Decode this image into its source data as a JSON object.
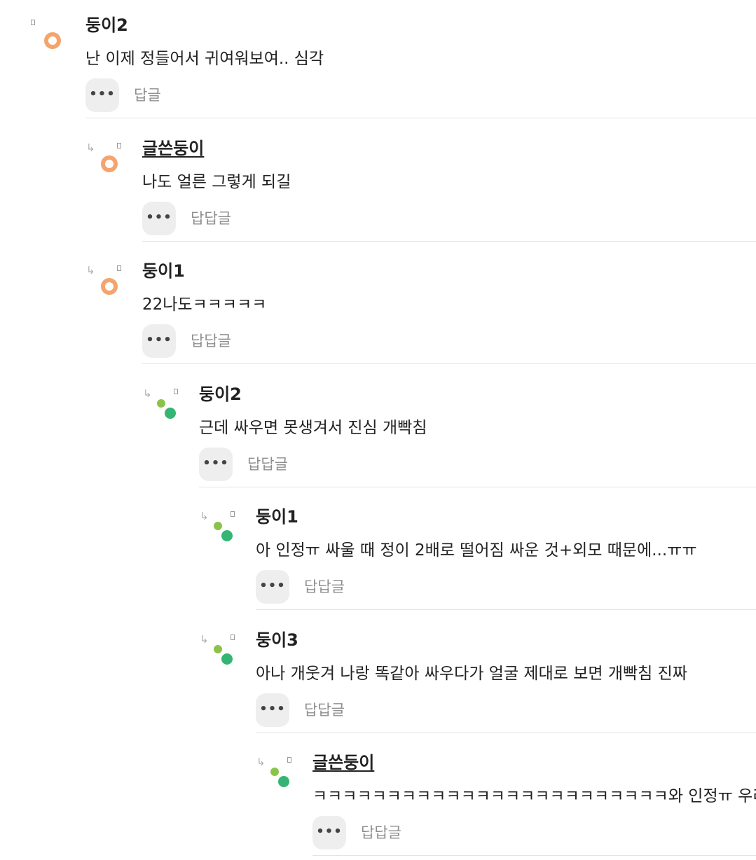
{
  "icons": {
    "reply_arrow": "reply-arrow-icon",
    "more": "more-options-icon",
    "marker": "status-marker-icon"
  },
  "colors": {
    "avatar_orange": "#f4a46c",
    "avatar_green_light": "#8bc34a",
    "avatar_green_dark": "#35b573"
  },
  "comments": [
    {
      "author": "둥이2",
      "text": "난 이제 정들어서 귀여워보여.. 심각",
      "more_label": "•••",
      "reply_label": "답글",
      "is_writer": false,
      "avatar": "orange",
      "depth": 0
    },
    {
      "author": "글쓴둥이",
      "text": "나도 얼른 그렇게 되길",
      "more_label": "•••",
      "reply_label": "답답글",
      "is_writer": true,
      "avatar": "orange",
      "depth": 1
    },
    {
      "author": "둥이1",
      "text": "22나도ㅋㅋㅋㅋㅋ",
      "more_label": "•••",
      "reply_label": "답답글",
      "is_writer": false,
      "avatar": "orange",
      "depth": 1
    },
    {
      "author": "둥이2",
      "text": "근데 싸우면 못생겨서 진심 개빡침",
      "more_label": "•••",
      "reply_label": "답답글",
      "is_writer": false,
      "avatar": "green",
      "depth": 2
    },
    {
      "author": "둥이1",
      "text": "아 인정ㅠ 싸울 때 정이 2배로 떨어짐 싸운 것+외모 때문에...ㅠㅠ",
      "more_label": "•••",
      "reply_label": "답답글",
      "is_writer": false,
      "avatar": "green",
      "depth": 3
    },
    {
      "author": "둥이3",
      "text": "아나 개웃겨 나랑 똑같아 싸우다가 얼굴 제대로 보면 개빡침 진짜",
      "more_label": "•••",
      "reply_label": "답답글",
      "is_writer": false,
      "avatar": "green",
      "depth": 3
    },
    {
      "author": "글쓴둥이",
      "text": "ㅋㅋㅋㅋㅋㅋㅋㅋㅋㅋㅋㅋㅋㅋㅋㅋㅋㅋㅋㅋㅋㅋㅋㅋ와 인정ㅠ 우리",
      "more_label": "•••",
      "reply_label": "답답글",
      "is_writer": true,
      "avatar": "green",
      "depth": 4
    }
  ]
}
